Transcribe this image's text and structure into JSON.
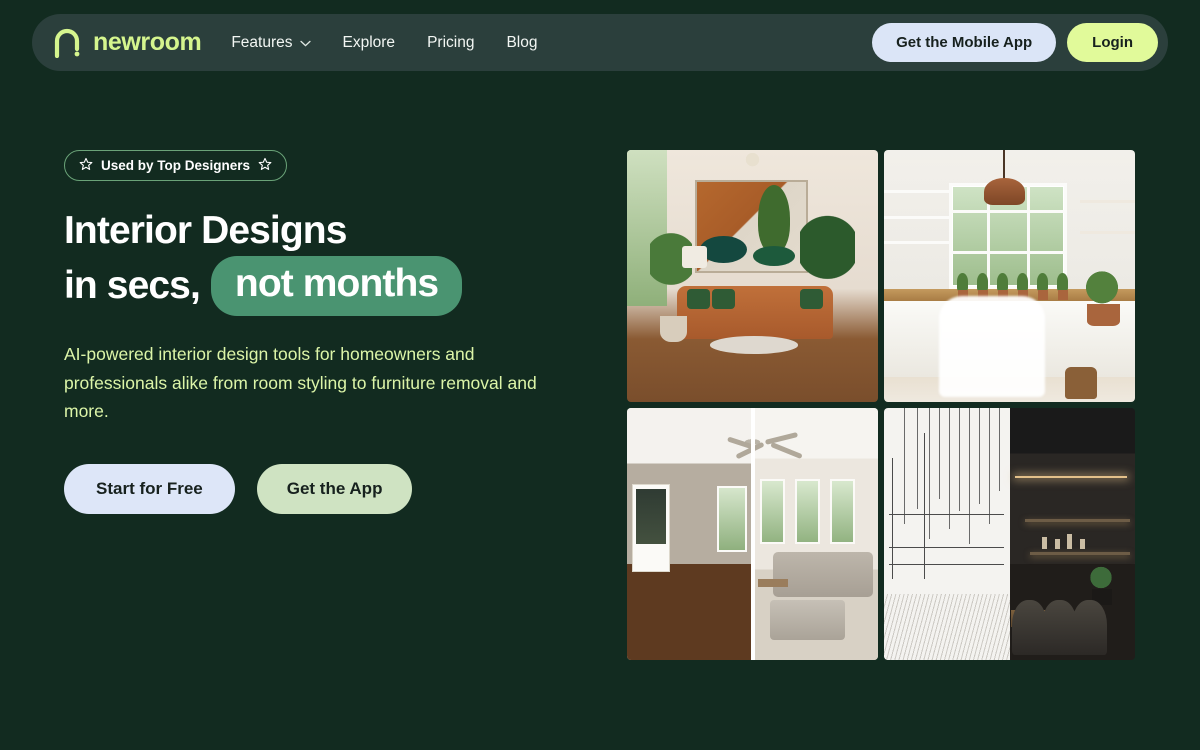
{
  "brand": {
    "name": "newroom",
    "logo_icon": "arch-logo-icon",
    "logo_color": "#d5f58e"
  },
  "navbar": {
    "links": [
      {
        "label": "Features",
        "has_dropdown": true,
        "icon": "chevron-down-icon"
      },
      {
        "label": "Explore",
        "has_dropdown": false
      },
      {
        "label": "Pricing",
        "has_dropdown": false
      },
      {
        "label": "Blog",
        "has_dropdown": false
      }
    ],
    "mobile_app_button": "Get the Mobile App",
    "login_button": "Login",
    "background_color": "#2b3f3c",
    "mobile_button_color": "#dbe5f7",
    "login_button_color": "#e1fa9a"
  },
  "hero": {
    "badge": {
      "text": "Used by Top Designers",
      "left_icon": "star-icon",
      "right_icon": "star-icon",
      "border_color": "#6aa378"
    },
    "headline_line1": "Interior Designs",
    "headline_line2_prefix": "in secs,",
    "headline_highlight": "not months",
    "highlight_color": "#4a9471",
    "subtitle": "AI-powered interior design tools for homeowners and professionals alike from room styling to furniture removal and more.",
    "subtitle_color": "#dcf5a8",
    "primary_cta": "Start for Free",
    "secondary_cta": "Get the App",
    "primary_cta_color": "#dde6f8",
    "secondary_cta_color": "#cfe3c2"
  },
  "gallery": {
    "tiles": [
      {
        "name": "living-room-photo",
        "caption": "Styled living room with tan leather sofa, green pillows, abstract wall art and indoor plants"
      },
      {
        "name": "kitchen-photo",
        "caption": "Bright white country kitchen with copper pendant lamp, potted herbs and windows"
      },
      {
        "name": "before-after-photo",
        "caption": "Before and after: empty room with hardwood floors versus furnished room with beige sectional"
      },
      {
        "name": "sketch-to-render-photo",
        "caption": "Architectural line sketch transformed into a dark moody rendered dining lounge"
      }
    ]
  },
  "theme": {
    "page_background": "#122b20",
    "text_white": "#ffffff"
  }
}
